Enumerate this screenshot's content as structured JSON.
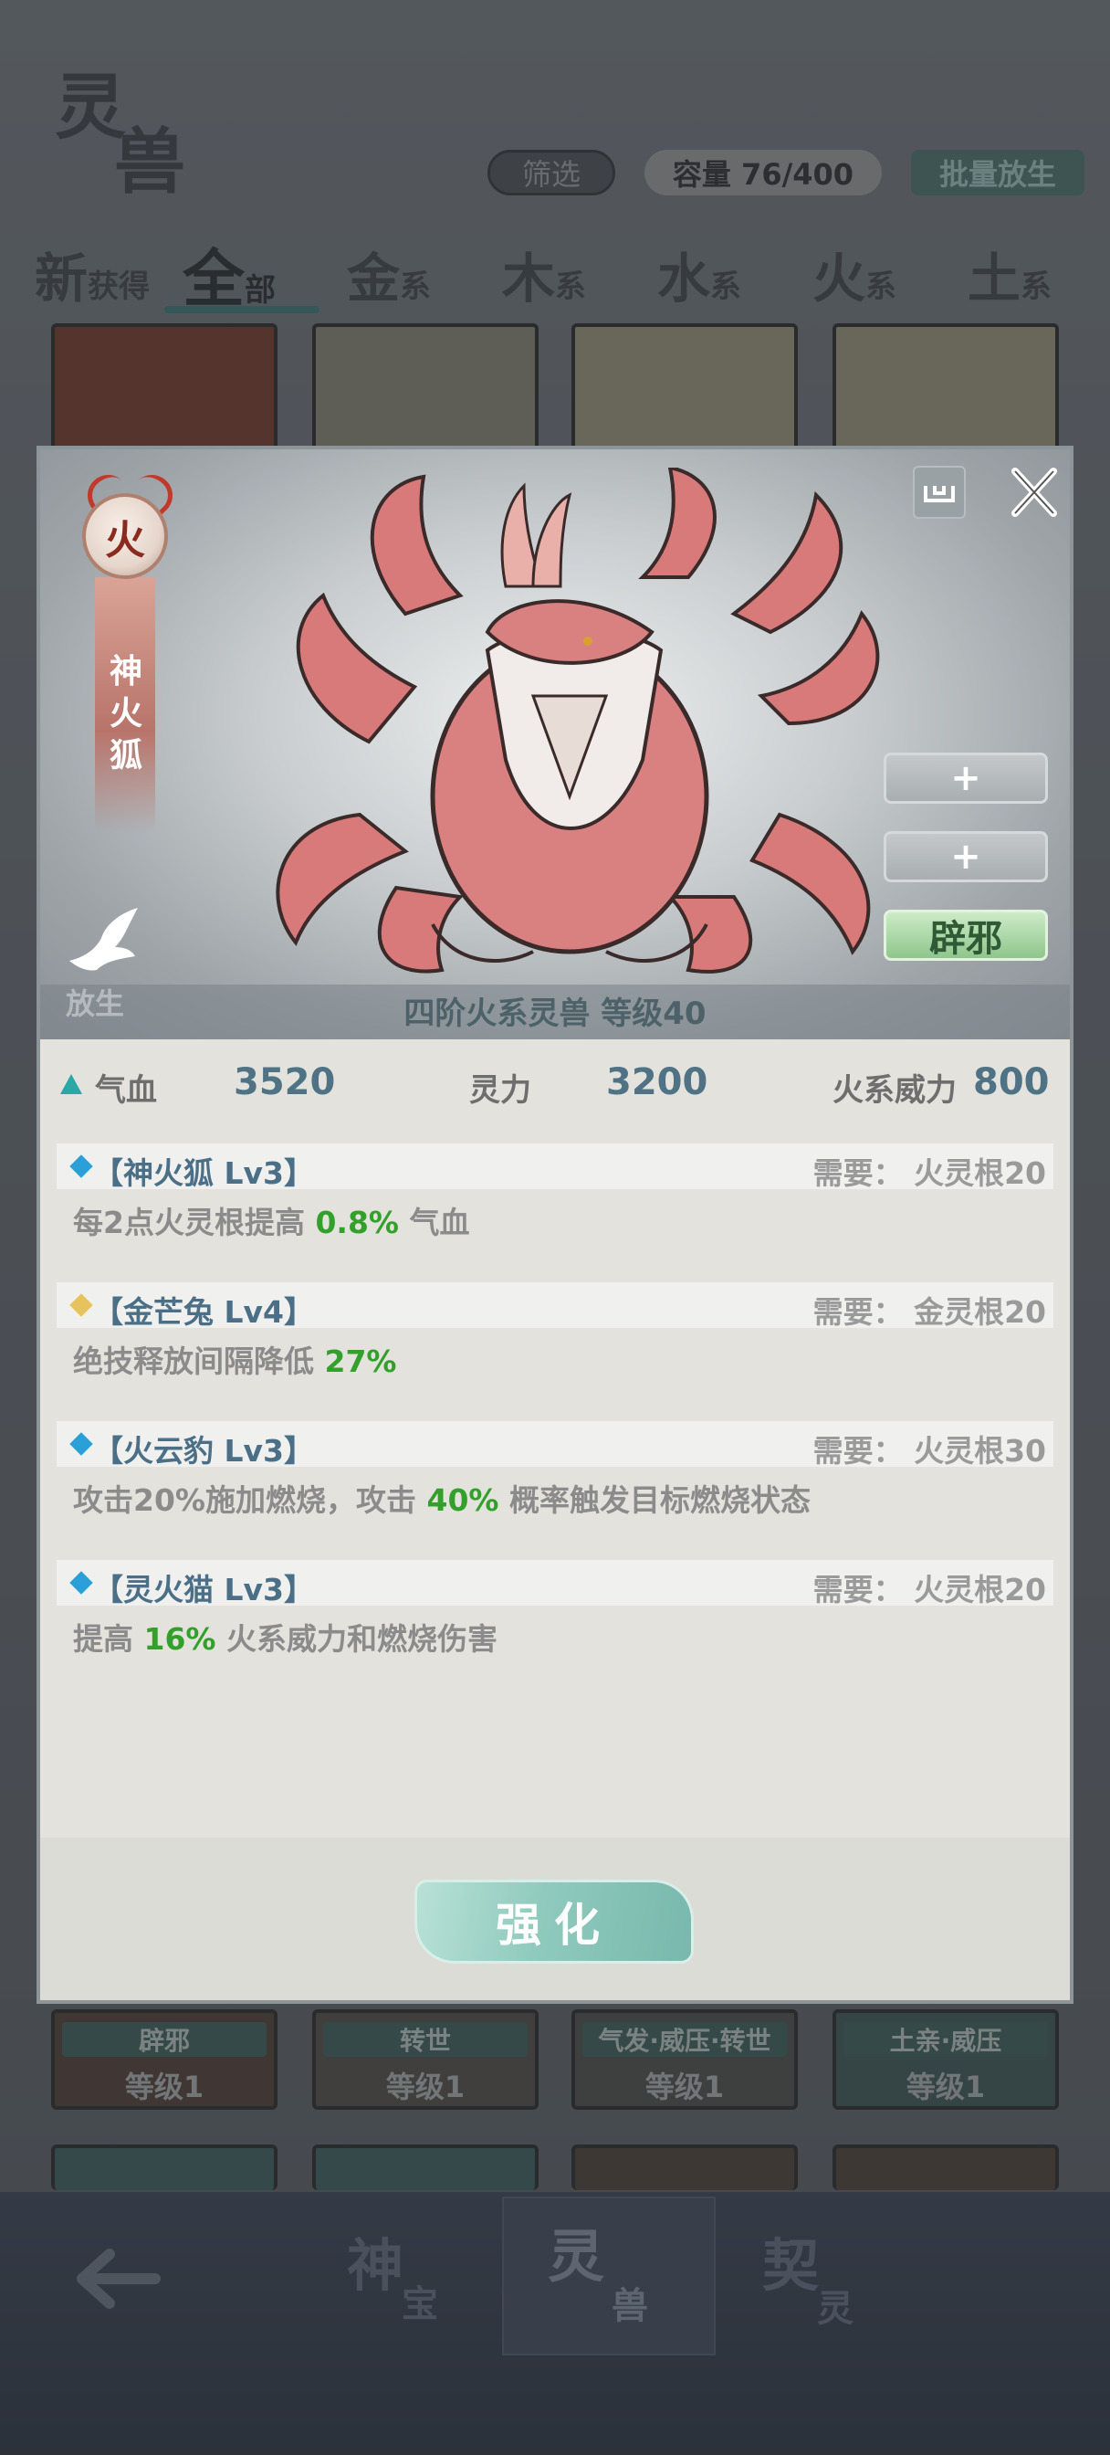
{
  "header": {
    "logo_char1": "灵",
    "logo_char2": "兽",
    "filter_label": "筛选",
    "capacity_label": "容量 76/400",
    "batch_release_label": "批量放生"
  },
  "tabs": [
    {
      "big": "新",
      "small": "获得"
    },
    {
      "big": "全",
      "small": "部"
    },
    {
      "big": "金",
      "small": "系"
    },
    {
      "big": "木",
      "small": "系"
    },
    {
      "big": "水",
      "small": "系"
    },
    {
      "big": "火",
      "small": "系"
    },
    {
      "big": "土",
      "small": "系"
    }
  ],
  "background_cards": [
    {
      "tag": "辟邪",
      "level": "等级1"
    },
    {
      "tag": "转世",
      "level": "等级1"
    },
    {
      "tag": "气发·威压·转世",
      "level": "等级1"
    },
    {
      "tag": "土亲·威压",
      "level": "等级1"
    }
  ],
  "bottom_nav": [
    {
      "big": "神",
      "small": "宝"
    },
    {
      "big": "灵",
      "small": "兽"
    },
    {
      "big": "契",
      "small": "灵"
    }
  ],
  "modal": {
    "element": "火",
    "beast_name_chars": [
      "神",
      "火",
      "狐"
    ],
    "release_label": "放生",
    "side_buttons": [
      "+",
      "+",
      "辟邪"
    ],
    "caption": "四阶火系灵兽   等级40",
    "stats": [
      {
        "label": "气血",
        "value": "3520"
      },
      {
        "label": "灵力",
        "value": "3200"
      },
      {
        "label": "火系威力",
        "value": "800"
      }
    ],
    "skills": [
      {
        "name": "【神火狐 Lv3】",
        "requirement": "需要： 火灵根20",
        "desc_pre": "每2点火灵根提高 ",
        "desc_hl": "0.8%",
        "desc_post": " 气血",
        "diamond_color": "#2a9fd8"
      },
      {
        "name": "【金芒兔 Lv4】",
        "requirement": "需要： 金灵根20",
        "desc_pre": "绝技释放间隔降低 ",
        "desc_hl": "27%",
        "desc_post": "",
        "diamond_color": "#e6c35c"
      },
      {
        "name": "【火云豹 Lv3】",
        "requirement": "需要： 火灵根30",
        "desc_pre": "攻击20%施加燃烧，攻击 ",
        "desc_hl": "40%",
        "desc_post": " 概率触发目标燃烧状态",
        "diamond_color": "#2a9fd8"
      },
      {
        "name": "【灵火猫 Lv3】",
        "requirement": "需要： 火灵根20",
        "desc_pre": "提高 ",
        "desc_hl": "16%",
        "desc_post": " 火系威力和燃烧伤害",
        "diamond_color": "#2a9fd8"
      }
    ],
    "upgrade_label": "强化"
  }
}
